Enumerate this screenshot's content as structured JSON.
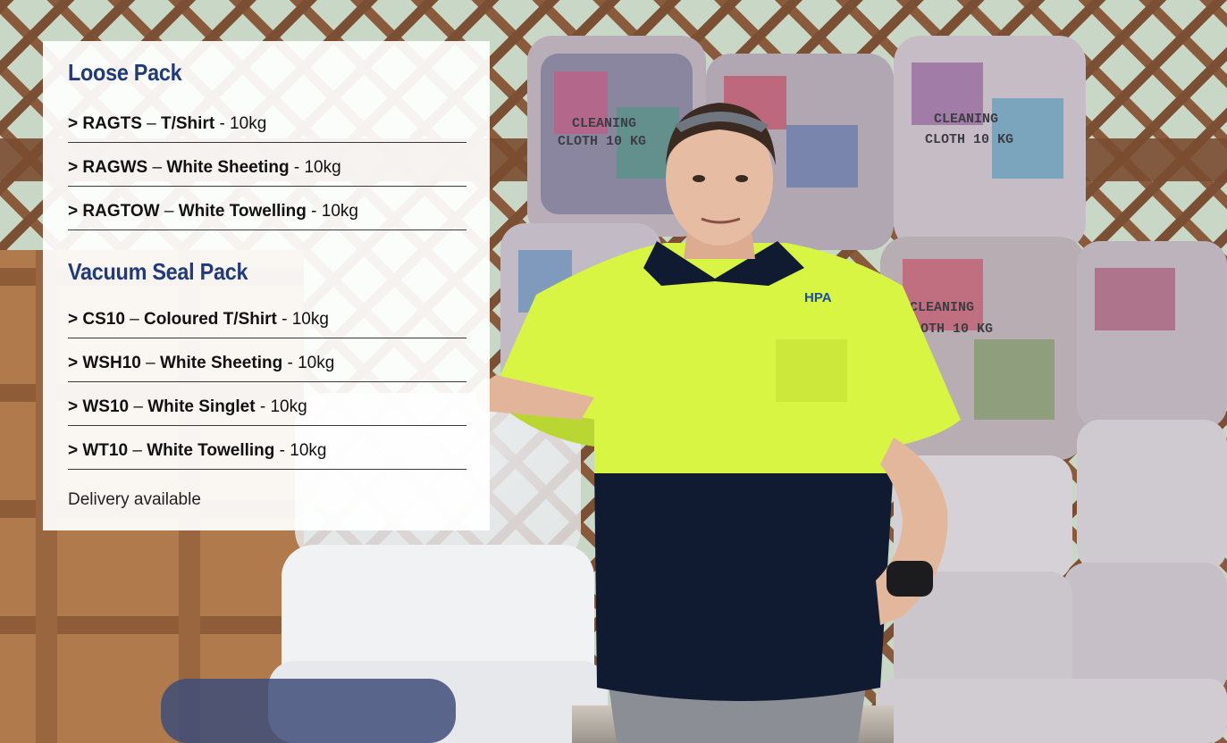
{
  "sections": [
    {
      "title": "Loose Pack",
      "items": [
        {
          "code": "> RAGTS",
          "sep": " – ",
          "name": "T/Shirt",
          "weight": " - 10kg"
        },
        {
          "code": "> RAGWS",
          "sep": " – ",
          "name": "White Sheeting",
          "weight": " - 10kg"
        },
        {
          "code": "> RAGTOW",
          "sep": " – ",
          "name": "White Towelling",
          "weight": " - 10kg"
        }
      ]
    },
    {
      "title": "Vacuum Seal Pack",
      "items": [
        {
          "code": "> CS10",
          "sep": " – ",
          "name": "Coloured T/Shirt",
          "weight": " - 10kg"
        },
        {
          "code": "> WSH10",
          "sep": " – ",
          "name": "White Sheeting",
          "weight": " - 10kg"
        },
        {
          "code": "> WS10",
          "sep": " – ",
          "name": "White Singlet",
          "weight": " - 10kg"
        },
        {
          "code": "> WT10",
          "sep": " – ",
          "name": "White Towelling",
          "weight": " - 10kg"
        }
      ]
    }
  ],
  "note": "Delivery available",
  "photo": {
    "bag_label_line1": "CLEANING",
    "bag_label_line2": "CLOTH 10 KG",
    "shirt_logo": "HPA",
    "colors": {
      "title": "#213a7c",
      "hi_vis": "#d7f542",
      "navy": "#101a30",
      "lattice": "#8a5a3c"
    }
  }
}
